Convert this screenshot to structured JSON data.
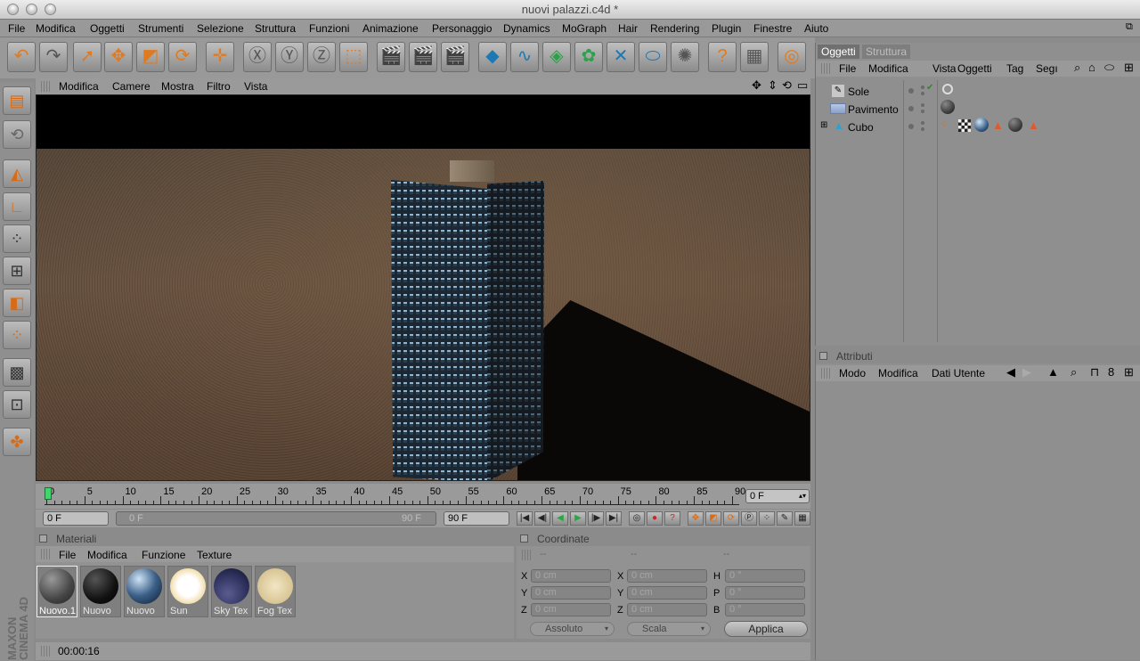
{
  "window": {
    "title": "nuovi palazzi.c4d *"
  },
  "menubar": [
    "File",
    "Modifica",
    "Oggetti",
    "Strumenti",
    "Selezione",
    "Struttura",
    "Funzioni",
    "Animazione",
    "Personaggio",
    "Dynamics",
    "MoGraph",
    "Hair",
    "Rendering",
    "Plugin",
    "Finestre",
    "Aiuto"
  ],
  "viewport": {
    "menu": [
      "Modifica",
      "Camere",
      "Mostra",
      "Filtro",
      "Vista"
    ]
  },
  "timeline": {
    "ticks": [
      "0",
      "5",
      "10",
      "15",
      "20",
      "25",
      "30",
      "35",
      "40",
      "45",
      "50",
      "55",
      "60",
      "65",
      "70",
      "75",
      "80",
      "85",
      "90"
    ],
    "current_frame": "0 F"
  },
  "playbar": {
    "start": "0 F",
    "range_start": "0 F",
    "range_end": "90 F",
    "end": "90 F"
  },
  "materials": {
    "title": "Materiali",
    "menu": [
      "File",
      "Modifica",
      "Funzione",
      "Texture"
    ],
    "items": [
      {
        "name": "Nuovo.1",
        "color": "#555"
      },
      {
        "name": "Nuovo",
        "color": "#111"
      },
      {
        "name": "Nuovo",
        "color": "#3b5f88"
      },
      {
        "name": "Sun",
        "color": "#ffffff"
      },
      {
        "name": "Sky Tex",
        "color": "#2c2f5a"
      },
      {
        "name": "Fog Tex",
        "color": "#e8d8a8"
      }
    ]
  },
  "coords": {
    "title": "Coordinate",
    "headers": [
      "--",
      "--",
      "--"
    ],
    "rows": [
      {
        "l1": "X",
        "v1": "0 cm",
        "l2": "X",
        "v2": "0 cm",
        "l3": "H",
        "v3": "0 °"
      },
      {
        "l1": "Y",
        "v1": "0 cm",
        "l2": "Y",
        "v2": "0 cm",
        "l3": "P",
        "v3": "0 °"
      },
      {
        "l1": "Z",
        "v1": "0 cm",
        "l2": "Z",
        "v2": "0 cm",
        "l3": "B",
        "v3": "0 °"
      }
    ],
    "mode": "Assoluto",
    "scale": "Scala",
    "apply": "Applica"
  },
  "status": {
    "time": "00:00:16"
  },
  "objects": {
    "tabs": [
      "Oggetti",
      "Struttura"
    ],
    "menu": [
      "File",
      "Modifica",
      "Vista",
      "Oggetti",
      "Tag",
      "Segı"
    ],
    "items": [
      {
        "name": "Sole"
      },
      {
        "name": "Pavimento"
      },
      {
        "name": "Cubo"
      }
    ]
  },
  "attributes": {
    "title": "Attributi",
    "menu": [
      "Modo",
      "Modifica",
      "Dati Utente"
    ]
  },
  "brand": {
    "line1": "MAXON",
    "line2": "CINEMA 4D"
  }
}
